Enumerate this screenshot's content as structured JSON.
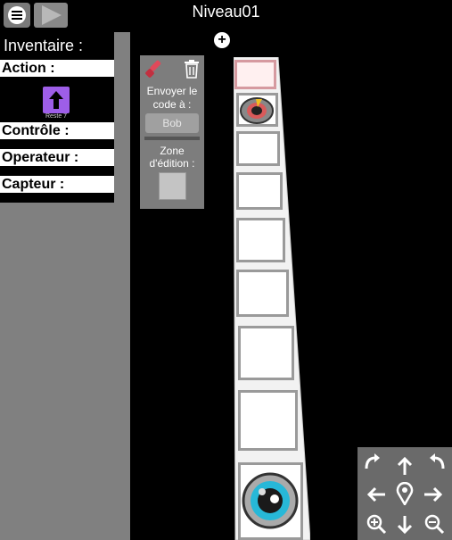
{
  "header": {
    "title": "Niveau01",
    "add_label": "+"
  },
  "inventory": {
    "title": "Inventaire :",
    "categories": [
      "Action :",
      "Contrôle :",
      "Operateur :",
      "Capteur :"
    ],
    "action_item": {
      "icon": "arrow-up-icon",
      "remaining": "Reste 7",
      "color": "#9e5ee8"
    }
  },
  "agent_panel": {
    "send_label_line1": "Envoyer le",
    "send_label_line2": "code à :",
    "agent_name": "Bob",
    "edit_zone_line1": "Zone",
    "edit_zone_line2": "d'édition :",
    "icons": [
      "brush-icon",
      "trash-icon"
    ]
  },
  "script_strip": {
    "slot_count": 10,
    "start_icon": "robot-start-icon",
    "end_icon": "robot-goal-icon"
  },
  "camera_controls": {
    "icons": [
      "rotate-left-icon",
      "arrow-up-icon",
      "rotate-right-icon",
      "arrow-left-icon",
      "focus-location-icon",
      "arrow-right-icon",
      "zoom-in-icon",
      "arrow-down-icon",
      "zoom-out-icon"
    ]
  }
}
